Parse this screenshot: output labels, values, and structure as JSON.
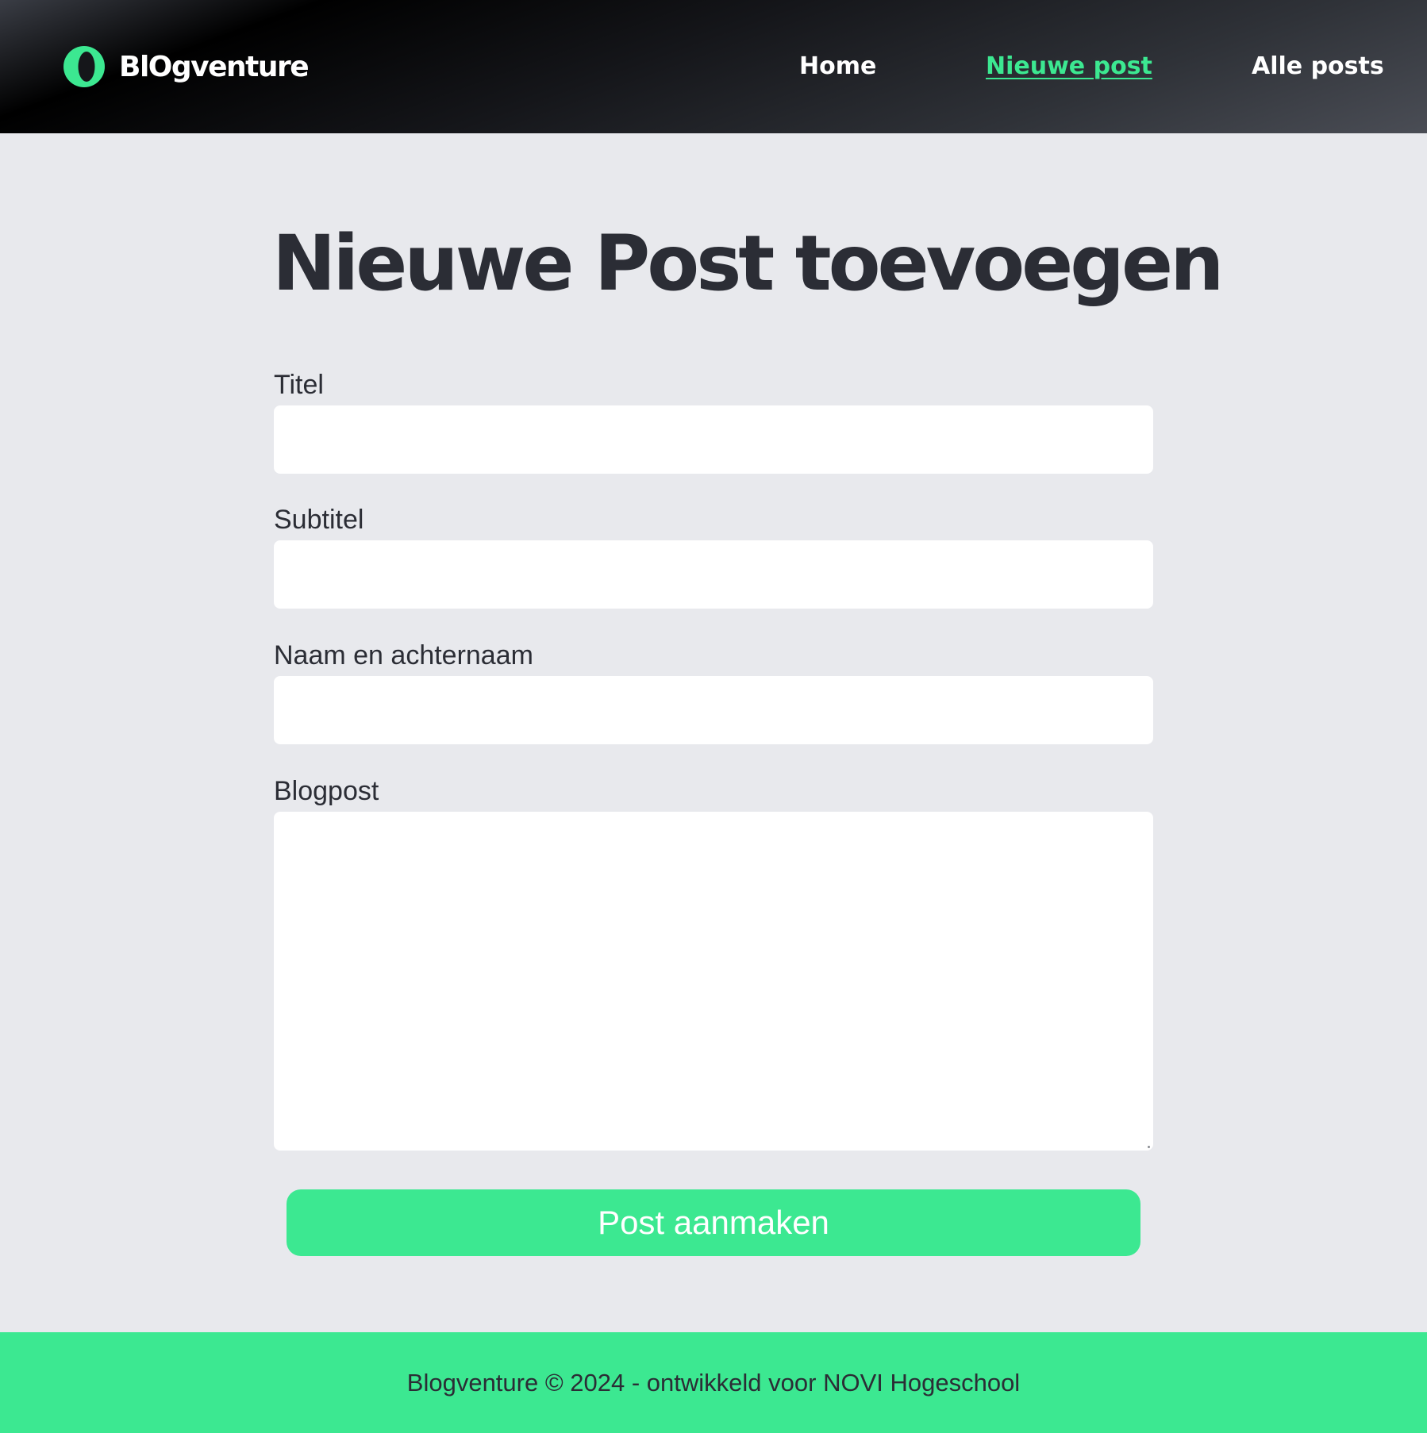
{
  "brand": {
    "name": "BlOgventure",
    "accent_color": "#3ce891",
    "logo_icon": "crescent-ring-icon"
  },
  "nav": {
    "items": [
      {
        "label": "Home",
        "active": false
      },
      {
        "label": "Nieuwe post",
        "active": true
      },
      {
        "label": "Alle posts",
        "active": false
      }
    ]
  },
  "main": {
    "title": "Nieuwe Post toevoegen",
    "fields": {
      "title_label": "Titel",
      "title_value": "",
      "subtitle_label": "Subtitel",
      "subtitle_value": "",
      "author_label": "Naam en achternaam",
      "author_value": "",
      "body_label": "Blogpost",
      "body_value": ""
    },
    "submit_label": "Post aanmaken"
  },
  "footer": {
    "text": "Blogventure © 2024 - ontwikkeld voor NOVI Hogeschool"
  },
  "colors": {
    "page_background": "#e8e9ed",
    "text": "#2b2d35",
    "header_dark": "#15161a"
  }
}
